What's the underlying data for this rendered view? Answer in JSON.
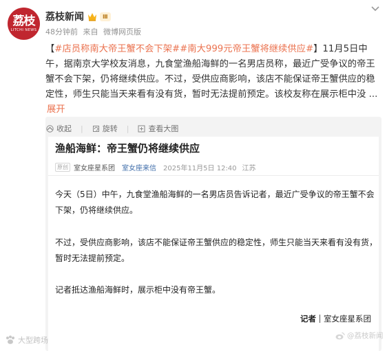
{
  "post": {
    "author": {
      "name": "荔枝新闻",
      "badge": "Ⅲ",
      "avatar_text": "荔枝",
      "avatar_subtext": "LITCHI NEWS",
      "avatar_color": "#c0262f"
    },
    "meta": {
      "time": "48分钟前",
      "source_prefix": "来自",
      "source": "微博网页版"
    },
    "body": {
      "topic1": "#店员称南大帝王蟹不会下架#",
      "topic2": "#南大999元帝王蟹将继续供应#",
      "text": "】11月5日中午，据南京大学校友消息，九食堂渔船海鲜的一名男店员称，最近广受争议的帝王蟹不会下架，仍将继续供应。不过，受供应商影响，该店不能保证帝王蟹供应的稳定性，师生只能当天来看有没有货，暂时无法提前预定。该校友称在展示柜中没 ...",
      "expand": "展开"
    },
    "accent_color": "#eb7350"
  },
  "actions": [
    {
      "label": "收起",
      "icon": "collapse-icon"
    },
    {
      "label": "旋转",
      "icon": "rotate-icon"
    },
    {
      "label": "查看大图",
      "icon": "zoom-icon"
    }
  ],
  "article": {
    "title": "渔船海鲜：帝王蟹仍将继续供应",
    "badge": "原创",
    "source": "室女座星系团",
    "account": "室女座来信",
    "date": "2025年11月5日 12:40",
    "location": "江苏",
    "paragraphs": [
      "今天（5日）中午，九食堂渔船海鲜的一名男店员告诉记者，最近广受争议的帝王蟹不会下架，仍将继续供应。",
      "不过，受供应商影响，该店不能保证帝王蟹供应的稳定性，师生只能当天来看有没有货，暂时无法提前预定。",
      "记者抵达渔船海鲜时，展示柜中没有帝王蟹。"
    ],
    "signature_label": "记者",
    "signature_org": "室女座星系团"
  },
  "watermarks": {
    "left": "大型跨场",
    "right": "@荔枝新闻"
  }
}
